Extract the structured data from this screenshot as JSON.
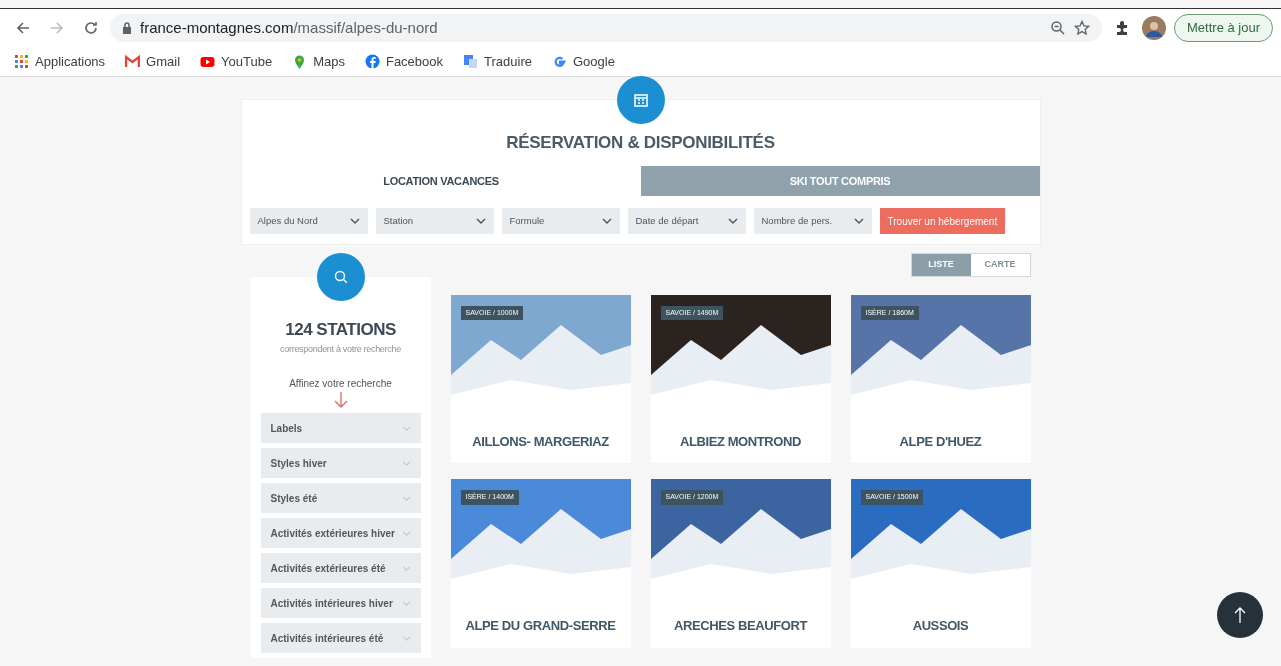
{
  "browser": {
    "url_domain": "france-montagnes.com",
    "url_path": "/massif/alpes-du-nord",
    "update_button": "Mettre à jour",
    "bookmarks": [
      {
        "label": "Applications"
      },
      {
        "label": "Gmail"
      },
      {
        "label": "YouTube"
      },
      {
        "label": "Maps"
      },
      {
        "label": "Facebook"
      },
      {
        "label": "Traduire"
      },
      {
        "label": "Google"
      }
    ]
  },
  "booking": {
    "title": "RÉSERVATION & DISPONIBILITÉS",
    "tabs": [
      {
        "label": "LOCATION VACANCES",
        "selected": true
      },
      {
        "label": "SKI TOUT COMPRIS",
        "selected": false
      }
    ],
    "selects": [
      {
        "label": "Alpes du Nord"
      },
      {
        "label": "Station"
      },
      {
        "label": "Formule"
      },
      {
        "label": "Date de départ"
      },
      {
        "label": "Nombre de pers."
      }
    ],
    "search_button": "Trouver un hébergement"
  },
  "results": {
    "count_title": "124 STATIONS",
    "subtitle": "correspondent à votre recherche",
    "refine": "Affinez votre recherche",
    "filters": [
      {
        "label": "Labels"
      },
      {
        "label": "Styles hiver"
      },
      {
        "label": "Styles été"
      },
      {
        "label": "Activités extérieures hiver"
      },
      {
        "label": "Activités extérieures été"
      },
      {
        "label": "Activités intérieures hiver"
      },
      {
        "label": "Activités intérieures été"
      }
    ],
    "view_toggle": [
      {
        "label": "LISTE",
        "selected": true
      },
      {
        "label": "CARTE",
        "selected": false
      }
    ],
    "stations": [
      {
        "tag": "SAVOIE / 1000M",
        "name": "AILLONS- MARGERIAZ"
      },
      {
        "tag": "SAVOIE / 1490M",
        "name": "ALBIEZ MONTROND"
      },
      {
        "tag": "ISÈRE / 1860M",
        "name": "ALPE D'HUEZ"
      },
      {
        "tag": "ISÈRE / 1400M",
        "name": "ALPE DU GRAND-SERRE"
      },
      {
        "tag": "SAVOIE / 1200M",
        "name": "ARECHES BEAUFORT"
      },
      {
        "tag": "SAVOIE / 1500M",
        "name": "AUSSOIS"
      }
    ]
  }
}
